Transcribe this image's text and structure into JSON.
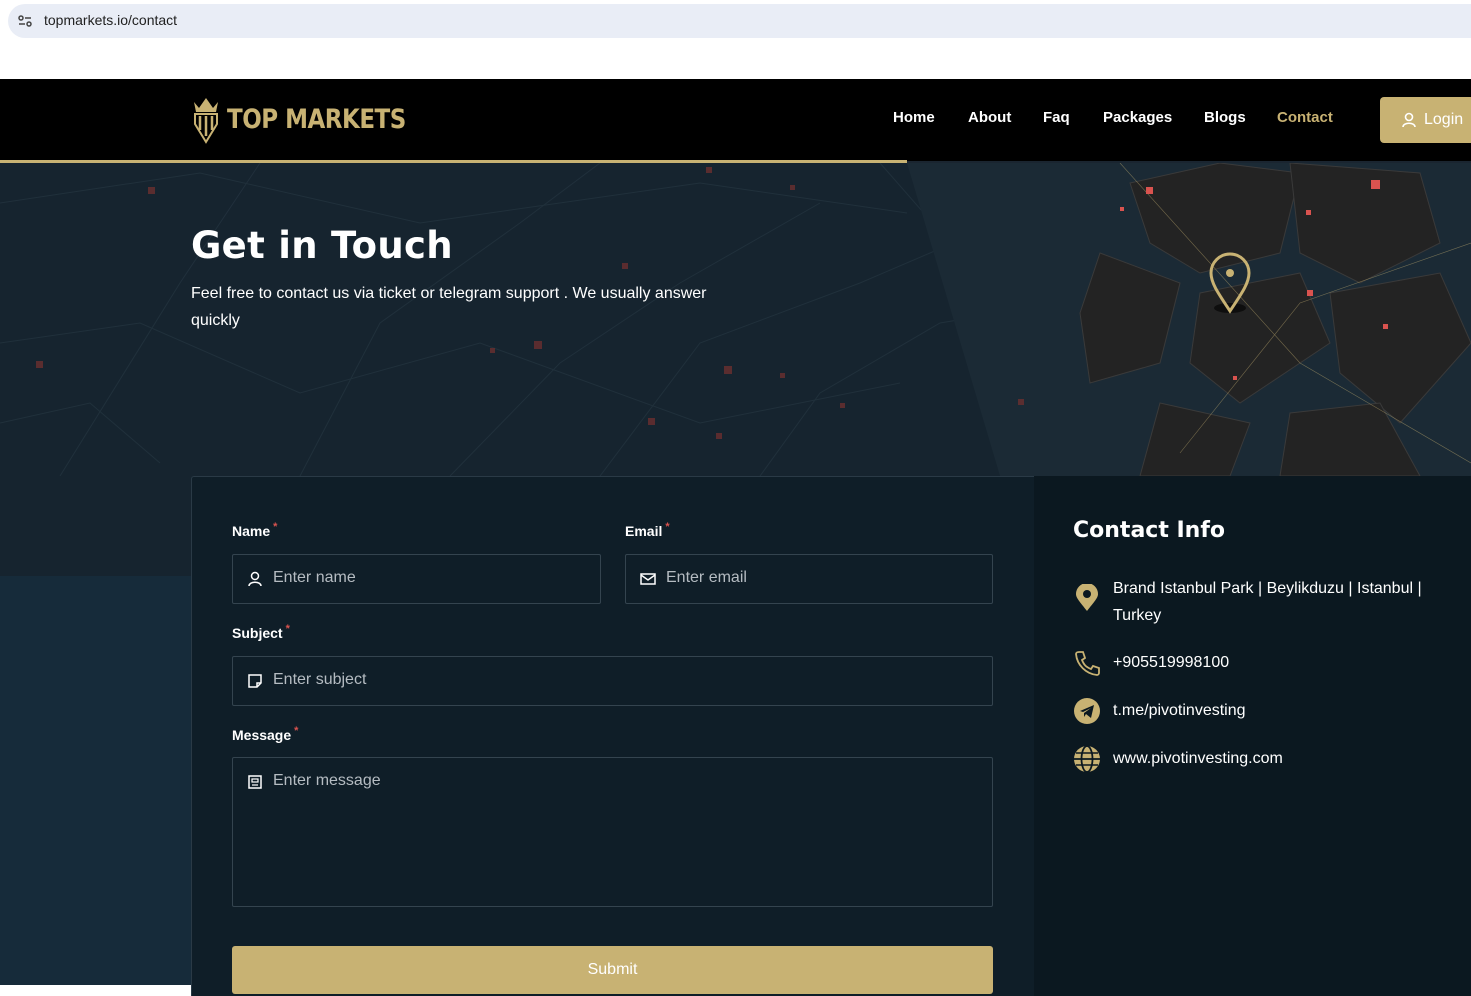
{
  "browser": {
    "url": "topmarkets.io/contact"
  },
  "header": {
    "logo_text": "TOP MARKETS",
    "nav": [
      {
        "label": "Home",
        "active": false
      },
      {
        "label": "About",
        "active": false
      },
      {
        "label": "Faq",
        "active": false
      },
      {
        "label": "Packages",
        "active": false
      },
      {
        "label": "Blogs",
        "active": false
      },
      {
        "label": "Contact",
        "active": true
      }
    ],
    "login_label": "Login"
  },
  "hero": {
    "title": "Get in Touch",
    "subtitle": "Feel free to contact us via ticket or telegram support . We usually answer quickly"
  },
  "form": {
    "name": {
      "label": "Name",
      "required_mark": "*",
      "placeholder": "Enter name",
      "icon": "user-icon"
    },
    "email": {
      "label": "Email",
      "required_mark": "*",
      "placeholder": "Enter email",
      "icon": "mail-icon"
    },
    "subject": {
      "label": "Subject",
      "required_mark": "*",
      "placeholder": "Enter subject",
      "icon": "note-icon"
    },
    "message": {
      "label": "Message",
      "required_mark": "*",
      "placeholder": "Enter message",
      "icon": "message-icon"
    },
    "submit_label": "Submit"
  },
  "contact_info": {
    "title": "Contact Info",
    "items": [
      {
        "icon": "location-pin-icon",
        "text": "Brand Istanbul Park | Beylikduzu | Istanbul | Turkey"
      },
      {
        "icon": "phone-icon",
        "text": "+905519998100"
      },
      {
        "icon": "telegram-icon",
        "text": "t.me/pivotinvesting"
      },
      {
        "icon": "globe-icon",
        "text": "www.pivotinvesting.com"
      }
    ]
  },
  "colors": {
    "accent_gold": "#c8b273",
    "header_bg": "#000000",
    "hero_bg": "#16242f",
    "card_bg": "#0f1e28",
    "required_red": "#d9534f"
  }
}
